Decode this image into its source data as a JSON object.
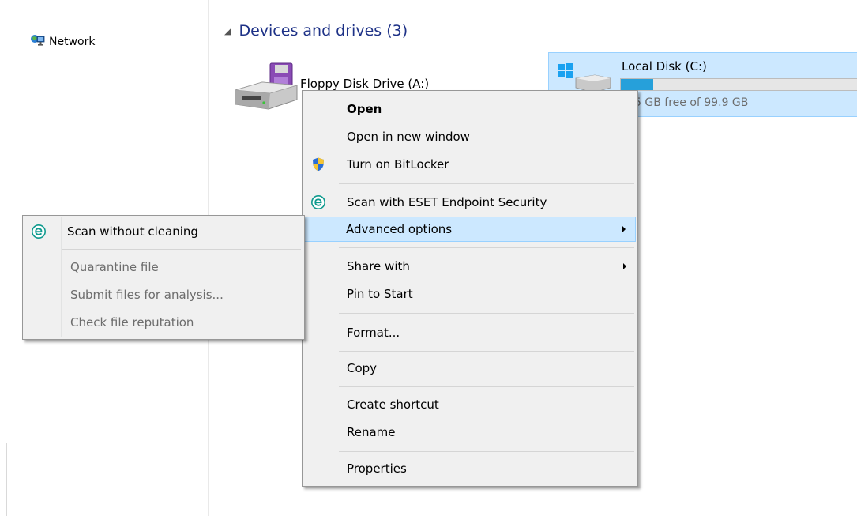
{
  "nav": {
    "network_label": "Network"
  },
  "devices_group": {
    "title": "Devices and drives (3)"
  },
  "drives": {
    "floppy": {
      "label": "Floppy Disk Drive (A:)"
    },
    "local_c": {
      "label": "Local Disk (C:)",
      "free_text": "5 GB free of 99.9 GB",
      "used_fraction": 0.13
    }
  },
  "context_menu": {
    "items": [
      {
        "label": "Open"
      },
      {
        "label": "Open in new window"
      },
      {
        "label": "Turn on BitLocker"
      },
      {
        "label": "Scan with ESET Endpoint Security"
      },
      {
        "label": "Advanced options"
      },
      {
        "label": "Share with"
      },
      {
        "label": "Pin to Start"
      },
      {
        "label": "Format..."
      },
      {
        "label": "Copy"
      },
      {
        "label": "Create shortcut"
      },
      {
        "label": "Rename"
      },
      {
        "label": "Properties"
      }
    ]
  },
  "submenu": {
    "items": [
      {
        "label": "Scan without cleaning"
      },
      {
        "label": "Quarantine file"
      },
      {
        "label": "Submit files for analysis..."
      },
      {
        "label": "Check file reputation"
      }
    ]
  },
  "colors": {
    "group_title": "#1e3287",
    "selection_bg": "#cce8ff",
    "selection_border": "#99d1ff",
    "progress_fill": "#26a0da",
    "eset_teal": "#0f9a8e"
  },
  "icons": {
    "network": "network-icon",
    "floppy": "floppy-drive-icon",
    "local_disk": "windows-drive-icon",
    "bitlocker": "shield-icon",
    "eset": "eset-icon",
    "submenu_arrow": "chevron-right-icon"
  }
}
